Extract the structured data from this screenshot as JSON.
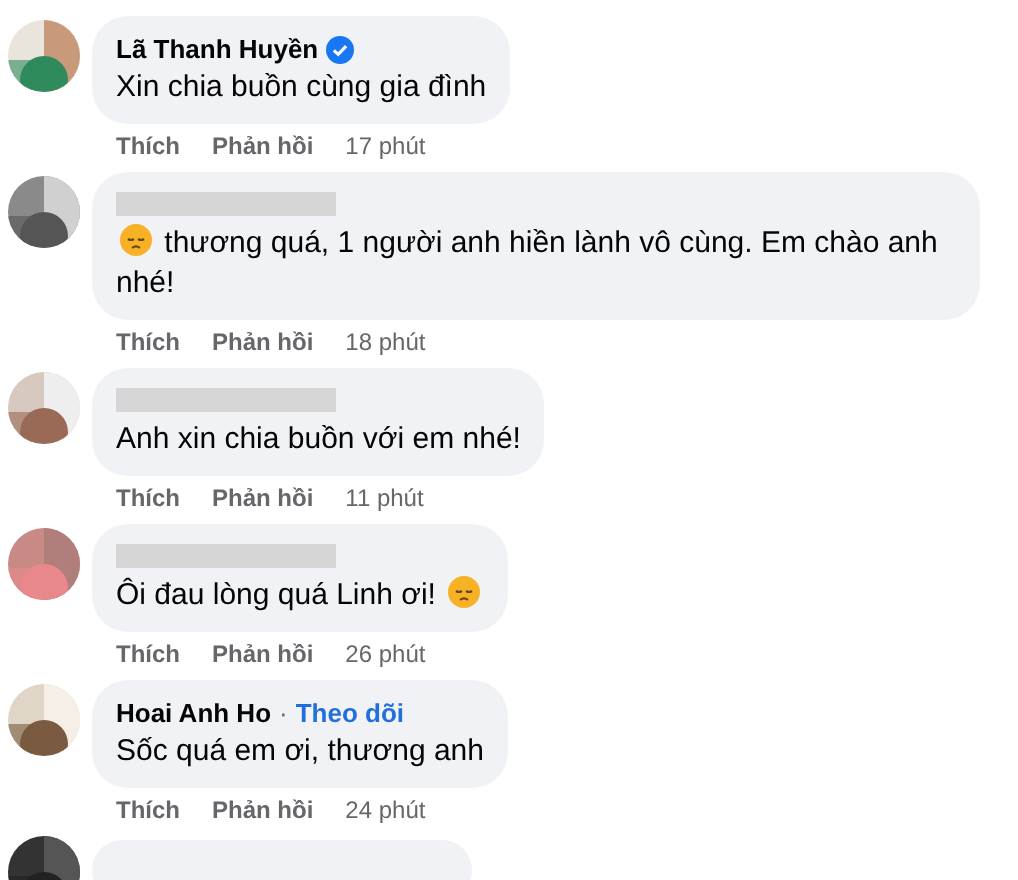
{
  "comments": [
    {
      "kind": "full",
      "author": "Lã Thanh Huyền",
      "verified": true,
      "text": "Xin chia buồn cùng gia đình",
      "actions": [
        "Thích",
        "Phản hồi"
      ],
      "time": "17 phút"
    },
    {
      "kind": "full",
      "author_hidden": true,
      "parts": [
        {
          "kind": "emoji"
        },
        {
          "kind": "text",
          "text": "thương quá, 1 người anh hiền lành vô cùng. Em chào anh nhé!"
        }
      ],
      "actions": [
        "Thích",
        "Phản hồi"
      ],
      "time": "18 phút"
    },
    {
      "kind": "full",
      "author_hidden": true,
      "text": "Anh xin chia buồn với em nhé!",
      "actions": [
        "Thích",
        "Phản hồi"
      ],
      "time": "11 phút"
    },
    {
      "kind": "full",
      "author_hidden": true,
      "parts": [
        {
          "kind": "text",
          "text": "Ôi đau lòng quá Linh ơi!"
        },
        {
          "kind": "emoji"
        }
      ],
      "actions": [
        "Thích",
        "Phản hồi"
      ],
      "time": "26 phút"
    },
    {
      "kind": "full",
      "author": "Hoai Anh Ho",
      "separator": "·",
      "follow": "Theo dõi",
      "text": "Sốc quá em ơi, thương anh",
      "actions": [
        "Thích",
        "Phản hồi"
      ],
      "time": "24 phút"
    },
    {
      "kind": "partial"
    }
  ]
}
